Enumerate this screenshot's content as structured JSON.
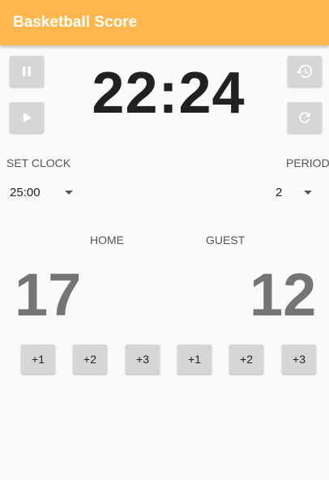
{
  "app": {
    "title": "Basketball Score"
  },
  "clock": {
    "time": "22:24"
  },
  "controls": {
    "pause_icon": "pause-icon",
    "play_icon": "play-icon",
    "history_icon": "restore-history-icon",
    "refresh_icon": "refresh-icon"
  },
  "set_clock": {
    "label": "SET CLOCK",
    "value": "25:00"
  },
  "period": {
    "label": "PERIOD",
    "value": "2"
  },
  "teams": {
    "home": {
      "label": "HOME",
      "score": "17"
    },
    "guest": {
      "label": "GUEST",
      "score": "12"
    }
  },
  "score_buttons": {
    "home": [
      "+1",
      "+2",
      "+3"
    ],
    "guest": [
      "+1",
      "+2",
      "+3"
    ]
  },
  "colors": {
    "appbar": "#ffb74d",
    "button": "#d6d6d6",
    "score": "#757575"
  }
}
